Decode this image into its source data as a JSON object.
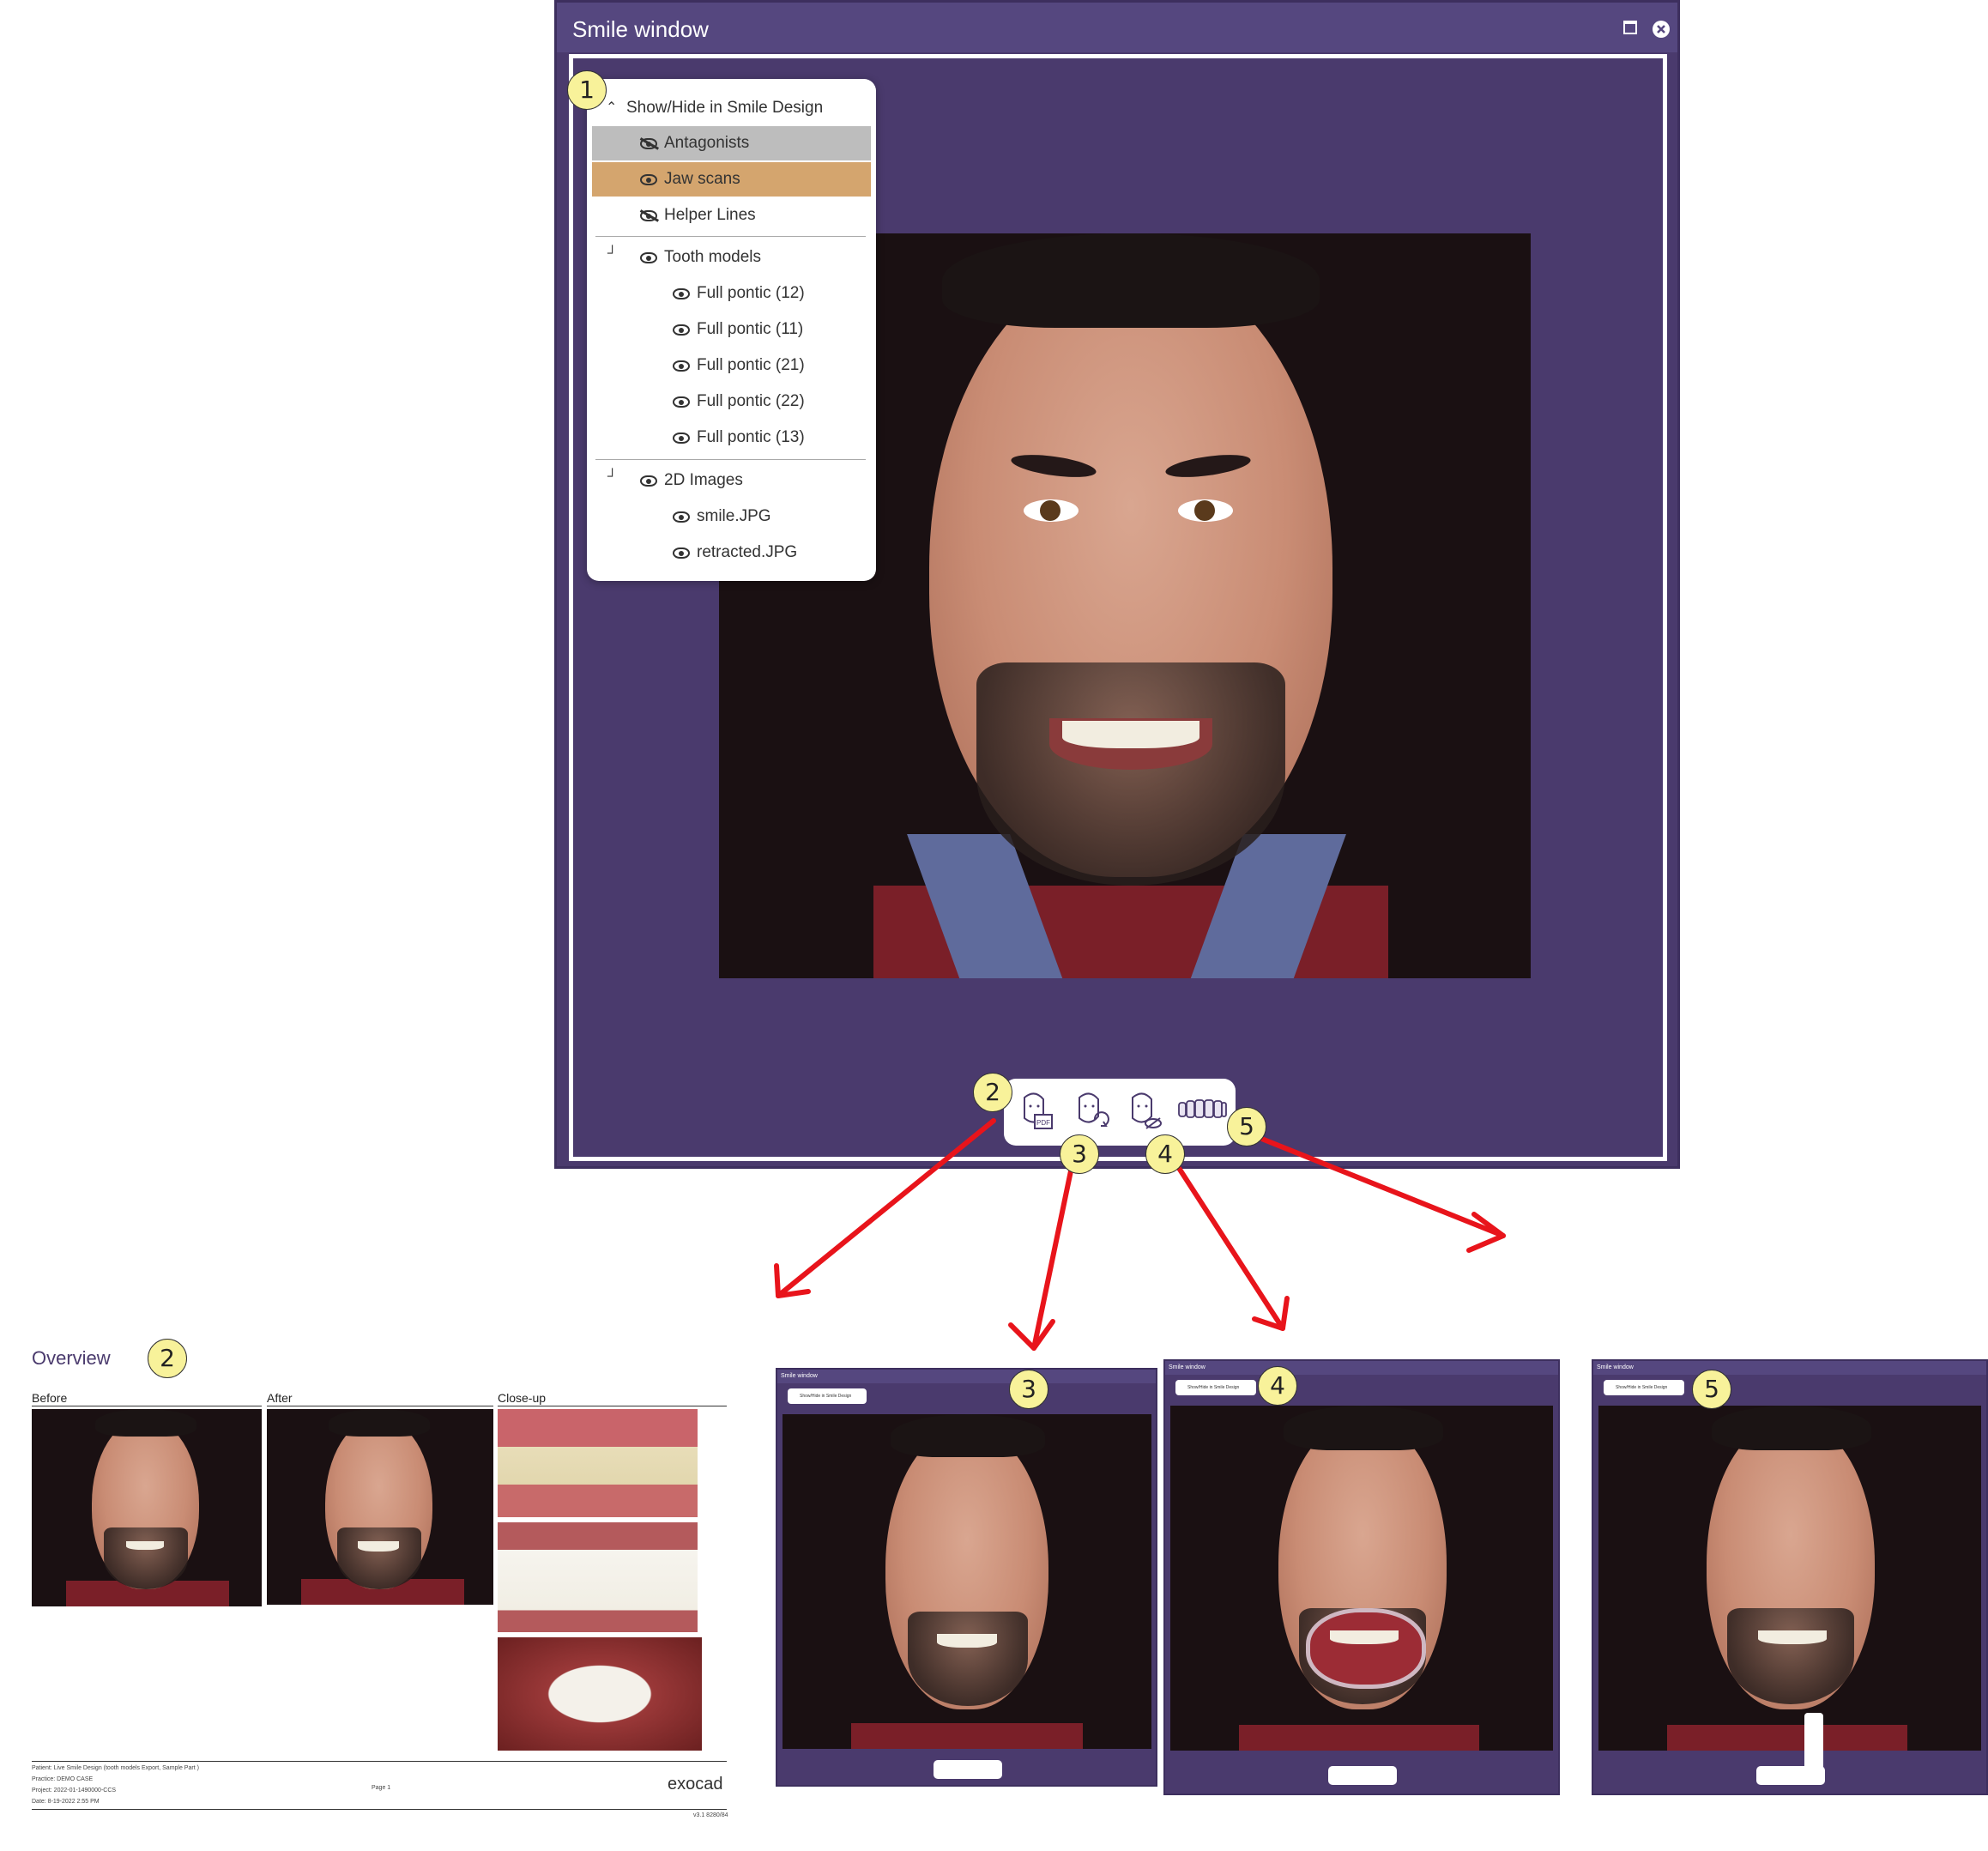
{
  "window": {
    "title": "Smile window",
    "maximize_icon": "maximize-icon",
    "close_icon": "close-icon"
  },
  "panel": {
    "header": "Show/Hide in Smile Design",
    "items": [
      {
        "label": "Antagonists",
        "visible": false,
        "highlight": "#bdbdbd"
      },
      {
        "label": "Jaw scans",
        "visible": true,
        "highlight": "#d4a56e"
      },
      {
        "label": "Helper Lines",
        "visible": false
      }
    ],
    "tooth_models": {
      "label": "Tooth models",
      "items": [
        "Full pontic (12)",
        "Full pontic (11)",
        "Full pontic (21)",
        "Full pontic (22)",
        "Full pontic (13)"
      ]
    },
    "images": {
      "label": "2D Images",
      "items": [
        "smile.JPG",
        "retracted.JPG"
      ]
    }
  },
  "callouts": [
    "1",
    "2",
    "3",
    "4",
    "5"
  ],
  "toolbar": {
    "tools": [
      "pdf-export-icon",
      "face-swap-icon",
      "face-hide-icon",
      "tooth-arch-icon"
    ],
    "pdf_label": "PDF"
  },
  "report": {
    "title": "Overview",
    "columns": [
      "Before",
      "After",
      "Close-up"
    ],
    "footer": {
      "patient": "Patient:   Live Smile Design (tooth models Export, Sample Part )",
      "practice": "Practice:   DEMO CASE",
      "project": "Project:   2022-01-1490000-CCS",
      "date": "Date:     8-19-2022 2:55 PM",
      "page": "Page 1",
      "brand": "exocad",
      "version": "v3.1 8280/84"
    }
  },
  "thumbnails": [
    {
      "title": "Smile window",
      "pill": "Show/Hide in Smile Design"
    },
    {
      "title": "Smile window",
      "pill": "Show/Hide in Smile Design"
    },
    {
      "title": "Smile window",
      "pill": "Show/Hide in Smile Design"
    }
  ],
  "colors": {
    "window_bg": "#4a3a6d",
    "title_bar": "#55477f",
    "arrow": "#e8141b",
    "callout_fill": "#f8f29a"
  }
}
